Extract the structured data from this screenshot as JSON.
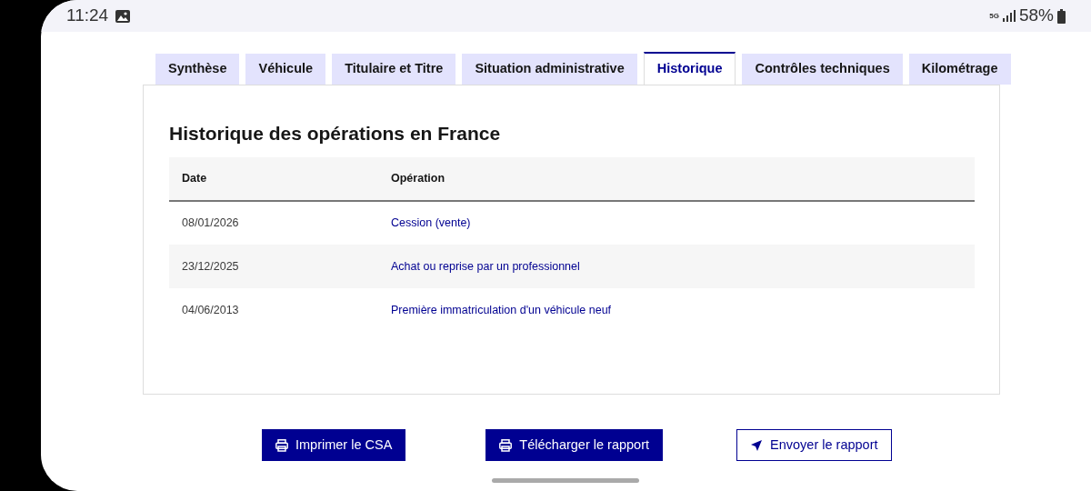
{
  "status_bar": {
    "time": "11:24",
    "network": "5G",
    "battery": "58%"
  },
  "tabs": [
    {
      "label": "Synthèse",
      "selected": false
    },
    {
      "label": "Véhicule",
      "selected": false
    },
    {
      "label": "Titulaire et Titre",
      "selected": false
    },
    {
      "label": "Situation administrative",
      "selected": false
    },
    {
      "label": "Historique",
      "selected": true
    },
    {
      "label": "Contrôles techniques",
      "selected": false
    },
    {
      "label": "Kilométrage",
      "selected": false
    }
  ],
  "panel": {
    "title": "Historique des opérations en France",
    "table": {
      "columns": [
        "Date",
        "Opération"
      ],
      "rows": [
        [
          "08/01/2026",
          "Cession (vente)"
        ],
        [
          "23/12/2025",
          "Achat ou reprise par un professionnel"
        ],
        [
          "04/06/2013",
          "Première immatriculation d'un véhicule neuf"
        ]
      ]
    }
  },
  "buttons": [
    {
      "label": "Imprimer le CSA",
      "kind": "primary"
    },
    {
      "label": "Télécharger le rapport",
      "kind": "primary"
    },
    {
      "label": "Envoyer le rapport",
      "kind": "secondary"
    }
  ]
}
